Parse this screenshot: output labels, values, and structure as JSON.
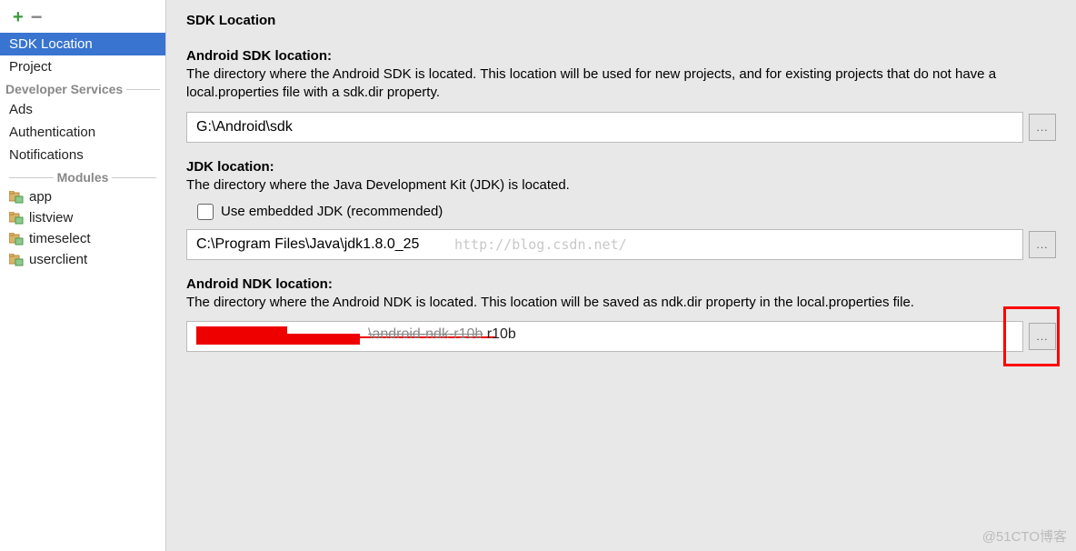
{
  "sidebar": {
    "items": [
      {
        "label": "SDK Location",
        "selected": true
      },
      {
        "label": "Project",
        "selected": false
      }
    ],
    "dev_services_header": "Developer Services",
    "dev_services": [
      {
        "label": "Ads"
      },
      {
        "label": "Authentication"
      },
      {
        "label": "Notifications"
      }
    ],
    "modules_header": "Modules",
    "modules": [
      {
        "label": "app"
      },
      {
        "label": "listview"
      },
      {
        "label": "timeselect"
      },
      {
        "label": "userclient"
      }
    ]
  },
  "page": {
    "title": "SDK Location",
    "sdk": {
      "heading": "Android SDK location:",
      "desc": "The directory where the Android SDK is located. This location will be used for new projects, and for existing projects that do not have a local.properties file with a sdk.dir property.",
      "value": "G:\\Android\\sdk"
    },
    "jdk": {
      "heading": "JDK location:",
      "desc": "The directory where the Java Development Kit (JDK) is located.",
      "checkbox_label": "Use embedded JDK (recommended)",
      "checked": false,
      "value": "C:\\Program Files\\Java\\jdk1.8.0_25",
      "watermark": "http://blog.csdn.net/"
    },
    "ndk": {
      "heading": "Android NDK location:",
      "desc": "The directory where the Android NDK is located. This location will be saved as ndk.dir property in the local.properties file.",
      "value_visible_fragment": "\\android-ndk-r10b",
      "value_suffix": "r10b"
    }
  },
  "browse_label": "...",
  "corner_watermark": "@51CTO博客"
}
